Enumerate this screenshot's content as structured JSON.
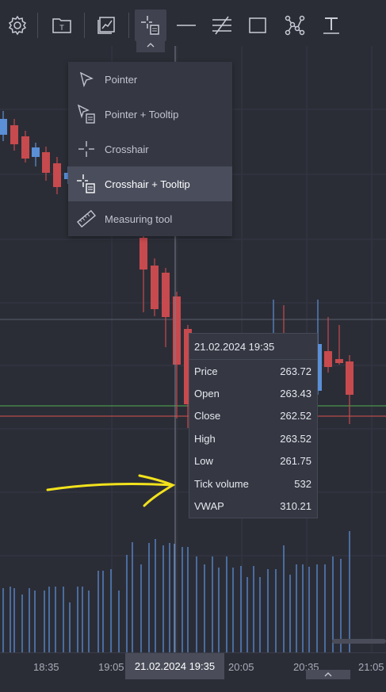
{
  "toolbar": {
    "tools": [
      {
        "icon": "gear-icon",
        "name": "settings"
      },
      {
        "icon": "template-icon",
        "name": "templates"
      },
      {
        "icon": "chart-type-icon",
        "name": "chart-type"
      },
      {
        "icon": "crosshair-tooltip-icon",
        "name": "cursor-mode",
        "active": true
      },
      {
        "icon": "horizontal-line-icon",
        "name": "horizontal-line"
      },
      {
        "icon": "trend-lines-icon",
        "name": "trend-lines"
      },
      {
        "icon": "rectangle-icon",
        "name": "rectangle"
      },
      {
        "icon": "pattern-icon",
        "name": "patterns"
      },
      {
        "icon": "text-icon",
        "name": "text"
      }
    ]
  },
  "cursor_menu": {
    "items": [
      {
        "label": "Pointer",
        "icon": "pointer-icon",
        "selected": false
      },
      {
        "label": "Pointer + Tooltip",
        "icon": "pointer-tooltip-icon",
        "selected": false
      },
      {
        "label": "Crosshair",
        "icon": "crosshair-icon",
        "selected": false
      },
      {
        "label": "Crosshair + Tooltip",
        "icon": "crosshair-tooltip-icon",
        "selected": true
      },
      {
        "label": "Measuring tool",
        "icon": "ruler-icon",
        "selected": false
      }
    ]
  },
  "tooltip": {
    "date": "21.02.2024 19:35",
    "rows": [
      {
        "label": "Price",
        "value": "263.72"
      },
      {
        "label": "Open",
        "value": "263.43"
      },
      {
        "label": "Close",
        "value": "262.52"
      },
      {
        "label": "High",
        "value": "263.52"
      },
      {
        "label": "Low",
        "value": "261.75"
      },
      {
        "label": "Tick volume",
        "value": "532"
      },
      {
        "label": "VWAP",
        "value": "310.21"
      }
    ]
  },
  "time_axis": {
    "ticks": [
      "18:35",
      "19:05",
      "20:05",
      "20:35",
      "21:05"
    ],
    "crosshair_label": "21.02.2024 19:35"
  },
  "colors": {
    "background": "#2b2d36",
    "bull": "#5b8fd6",
    "bear": "#c74a4e",
    "volume": "#5b8fd6",
    "annotation": "#f2e21c",
    "green_line": "#4caf50",
    "red_line": "#d9534f"
  }
}
